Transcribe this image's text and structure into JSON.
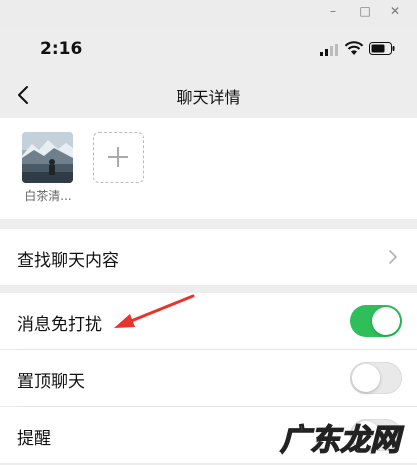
{
  "status_bar": {
    "time": "2:16"
  },
  "nav": {
    "title": "聊天详情"
  },
  "members": [
    {
      "name": "白茶清..."
    }
  ],
  "rows": {
    "search": {
      "label": "查找聊天内容"
    },
    "mute": {
      "label": "消息免打扰",
      "toggle_on": true
    },
    "pin": {
      "label": "置顶聊天",
      "toggle_on": false
    },
    "remind": {
      "label": "提醒",
      "toggle_on": false
    }
  },
  "annotation": {
    "arrow_color": "#e8342d"
  },
  "watermark": {
    "text": "广东龙网"
  },
  "colors": {
    "toggle_on": "#2fbf5a",
    "background": "#ededed"
  }
}
